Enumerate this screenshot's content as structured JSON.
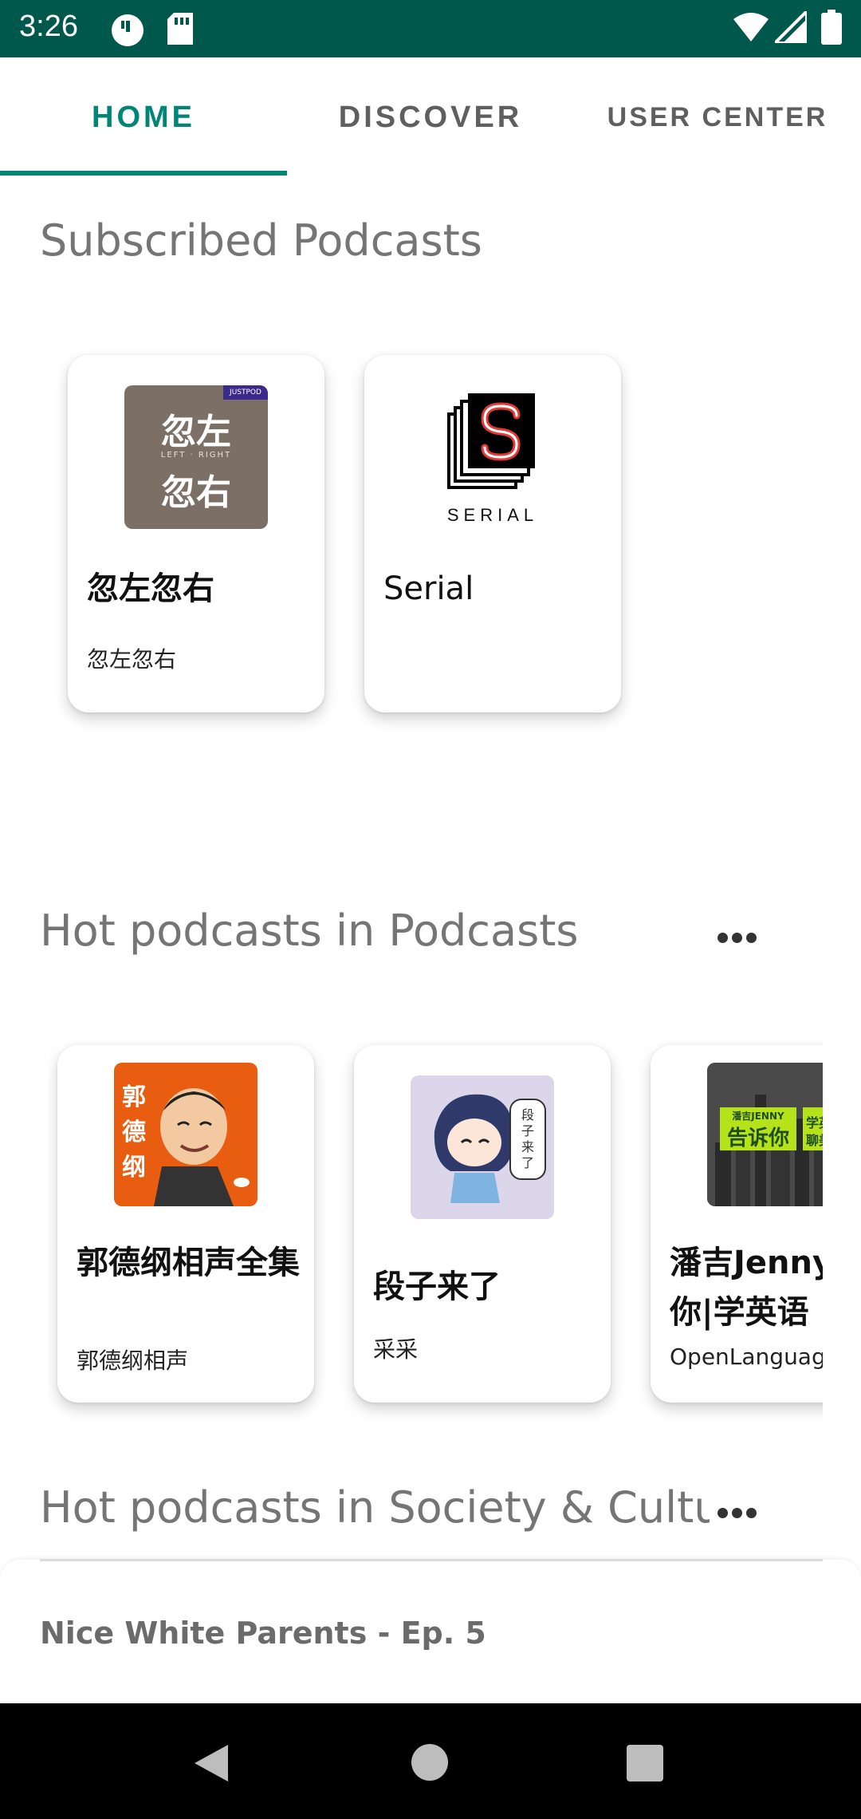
{
  "status_bar": {
    "time": "3:26"
  },
  "tabs": [
    {
      "label": "HOME",
      "active": true
    },
    {
      "label": "DISCOVER",
      "active": false
    },
    {
      "label": "USER CENTER",
      "active": false
    }
  ],
  "subscribed": {
    "title": "Subscribed Podcasts",
    "items": [
      {
        "name": "忽左忽右",
        "author": "忽左忽右",
        "cover_text": [
          "忽左",
          "LEFT · RIGHT",
          "忽右"
        ],
        "badge": "JUSTPOD"
      },
      {
        "name": "Serial",
        "author": "",
        "cover_text": [
          "SERIAL"
        ]
      }
    ]
  },
  "hot_podcasts": {
    "title": "Hot podcasts in Podcasts",
    "items": [
      {
        "name": "郭德纲相声全集",
        "author": "郭德纲相声",
        "cover_text": [
          "郭",
          "德",
          "纲"
        ]
      },
      {
        "name": "段子来了",
        "author": "采采",
        "cover_text": [
          "段子来了"
        ]
      },
      {
        "name": "潘吉Jenny告诉你|学英语",
        "author": "OpenLanguage",
        "cover_text": [
          "潘吉JENNY",
          "告诉你",
          "学英",
          "聊美"
        ]
      }
    ]
  },
  "hot_society": {
    "title": "Hot podcasts in Society & Culture"
  },
  "now_playing": {
    "title": "Nice White Parents - Ep. 5"
  },
  "colors": {
    "status_bar": "#00574b",
    "accent": "#008577",
    "title_grey": "#757575"
  },
  "icons": [
    "clock-icon",
    "sim-card-icon",
    "wifi-icon",
    "signal-icon",
    "battery-icon",
    "more-horiz-icon",
    "back-icon",
    "home-icon",
    "recents-icon"
  ]
}
